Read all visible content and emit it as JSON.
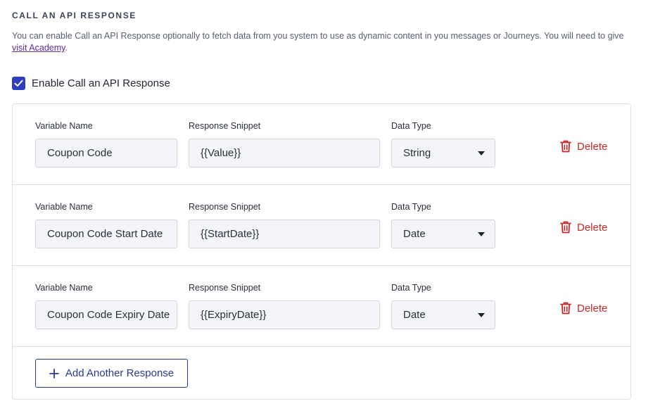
{
  "section": {
    "title": "CALL AN API RESPONSE",
    "description_line1": "You can enable Call an API Response optionally to fetch data from you system to use as dynamic content in you messages or Journeys. You will need to give",
    "academy_link": "visit Academy",
    "description_after_link": "."
  },
  "enable": {
    "label": "Enable Call an API Response",
    "checked": true
  },
  "labels": {
    "variable_name": "Variable Name",
    "response_snippet": "Response Snippet",
    "data_type": "Data Type",
    "delete": "Delete"
  },
  "responses": [
    {
      "variable_name": "Coupon Code",
      "response_snippet": "{{Value}}",
      "data_type": "String"
    },
    {
      "variable_name": "Coupon Code Start Date",
      "response_snippet": "{{StartDate}}",
      "data_type": "Date"
    },
    {
      "variable_name": "Coupon Code Expiry Date",
      "response_snippet": "{{ExpiryDate}}",
      "data_type": "Date"
    }
  ],
  "add_button": {
    "label": "Add Another Response",
    "icon": "plus-icon"
  },
  "colors": {
    "accent": "#2f3fc2",
    "button_border": "#2a3990",
    "delete": "#c62828",
    "link": "#5b2aa6"
  }
}
